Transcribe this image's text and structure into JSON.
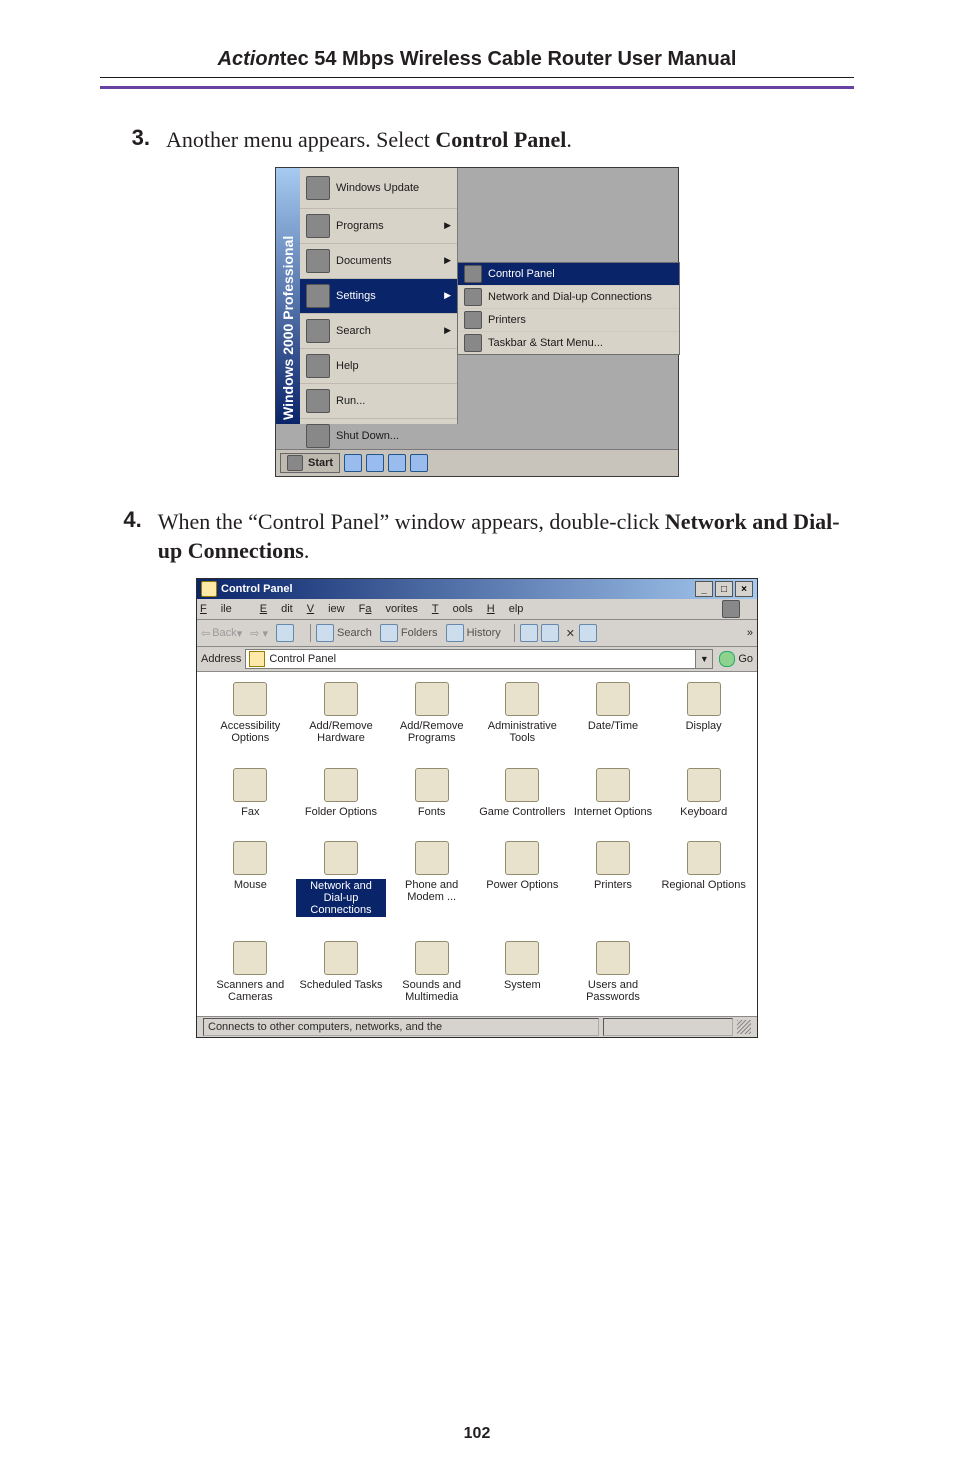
{
  "header": {
    "brand": "Action",
    "brand_suffix": "tec",
    "title_rest": " 54 Mbps Wireless Cable Router User Manual"
  },
  "steps": [
    {
      "num": "3.",
      "pre": "Another menu appears. Select ",
      "bold": "Control Panel",
      "post": "."
    },
    {
      "num": "4.",
      "pre": "When the “Control Panel” window appears, double-click ",
      "bold": "Network and Dial-up Connections",
      "post": "."
    }
  ],
  "startmenu": {
    "banner": "Windows 2000 Professional",
    "items": [
      {
        "label": "Windows Update",
        "arrow": false
      },
      {
        "label": "Programs",
        "arrow": true
      },
      {
        "label": "Documents",
        "arrow": true
      },
      {
        "label": "Settings",
        "arrow": true,
        "selected": true
      },
      {
        "label": "Search",
        "arrow": true
      },
      {
        "label": "Help",
        "arrow": false
      },
      {
        "label": "Run...",
        "arrow": false
      },
      {
        "label": "Shut Down...",
        "arrow": false
      }
    ],
    "submenu": [
      {
        "label": "Control Panel",
        "selected": true
      },
      {
        "label": "Network and Dial-up Connections",
        "selected": false
      },
      {
        "label": "Printers",
        "selected": false
      },
      {
        "label": "Taskbar & Start Menu...",
        "selected": false
      }
    ],
    "taskbar": {
      "start": "Start"
    }
  },
  "cpwin": {
    "title": "Control Panel",
    "menus": [
      "File",
      "Edit",
      "View",
      "Favorites",
      "Tools",
      "Help"
    ],
    "toolbar": {
      "back": "Back",
      "search": "Search",
      "folders": "Folders",
      "history": "History"
    },
    "address_label": "Address",
    "address_value": "Control Panel",
    "go": "Go",
    "icons": [
      "Accessibility Options",
      "Add/Remove Hardware",
      "Add/Remove Programs",
      "Administrative Tools",
      "Date/Time",
      "Display",
      "Fax",
      "Folder Options",
      "Fonts",
      "Game Controllers",
      "Internet Options",
      "Keyboard",
      "Mouse",
      "Network and Dial-up Connections",
      "Phone and Modem ...",
      "Power Options",
      "Printers",
      "Regional Options",
      "Scanners and Cameras",
      "Scheduled Tasks",
      "Sounds and Multimedia",
      "System",
      "Users and Passwords"
    ],
    "selected_index": 13,
    "status": "Connects to other computers, networks, and the "
  },
  "page_number": "102"
}
